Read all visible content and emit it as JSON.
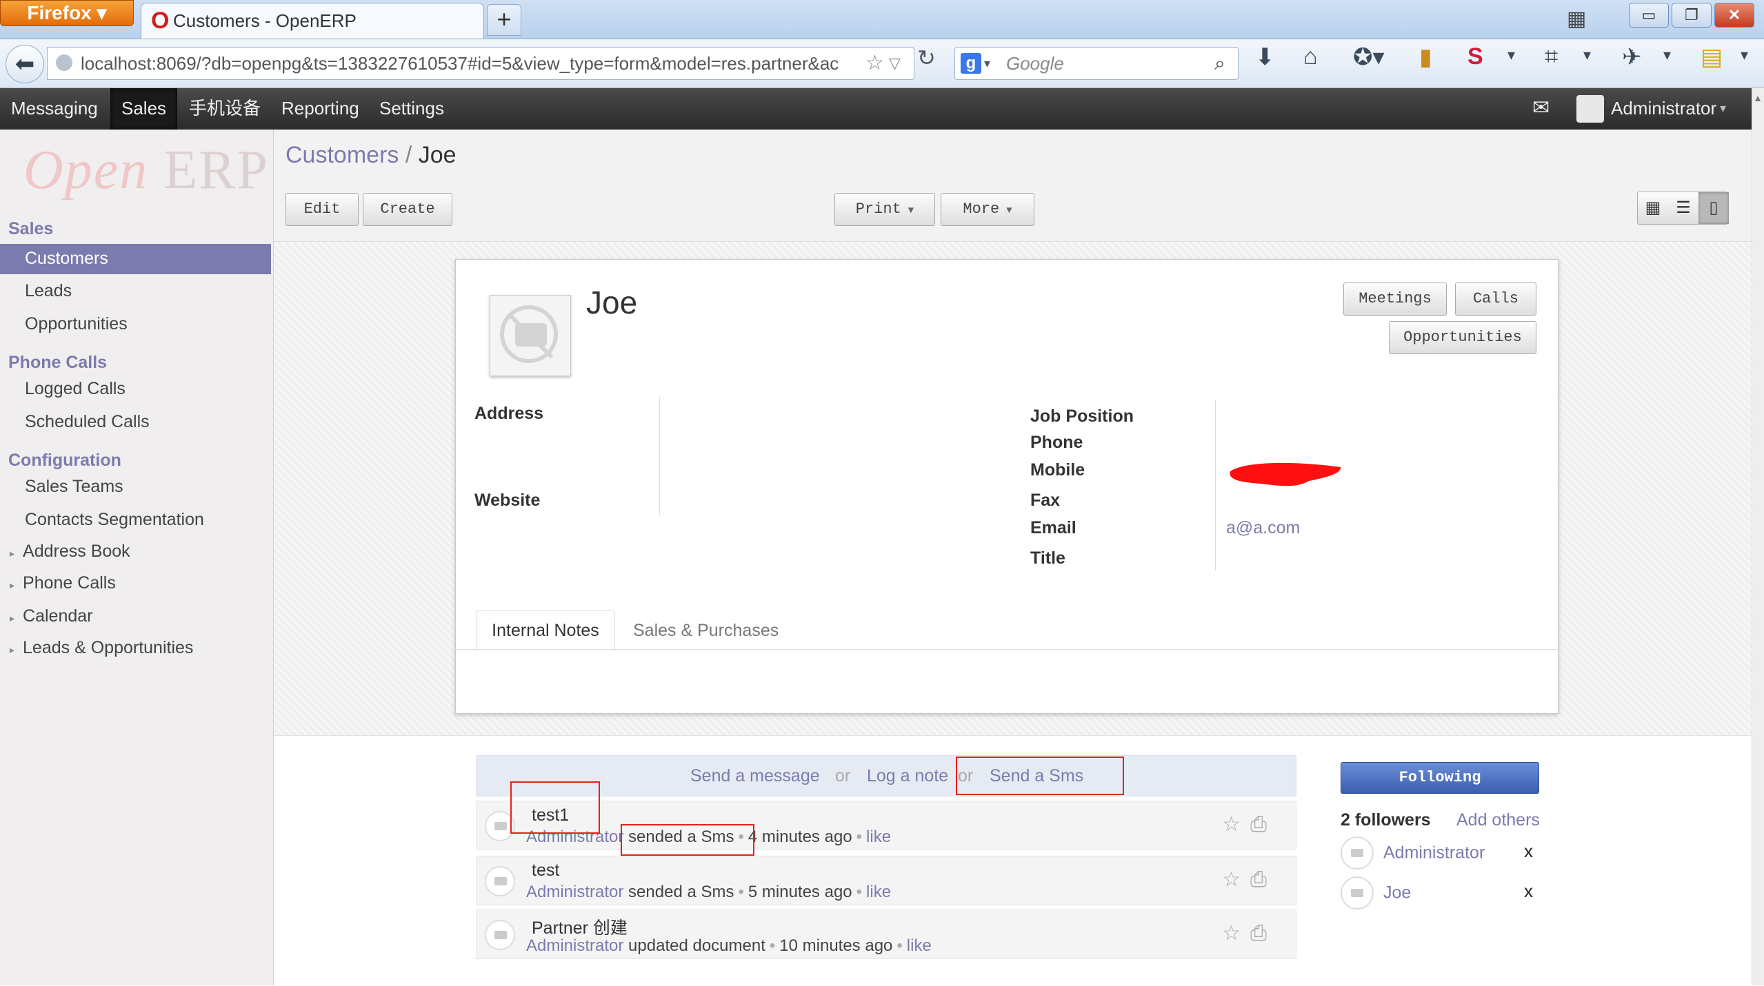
{
  "browser": {
    "menu_button": "Firefox",
    "tab_title": "Customers - OpenERP",
    "new_tab": "+",
    "url": "localhost:8069/?db=openpg&ts=1383227610537#id=5&view_type=form&model=res.partner&ac",
    "search_placeholder": "Google",
    "search_engine": "g"
  },
  "topbar": {
    "menus": [
      "Messaging",
      "Sales",
      "手机设备",
      "Reporting",
      "Settings"
    ],
    "active_menu": "Sales",
    "user": "Administrator"
  },
  "sidebar": {
    "logo_open": "Open",
    "logo_erp": "ERP",
    "sections": [
      {
        "title": "Sales",
        "items": [
          "Customers",
          "Leads",
          "Opportunities"
        ]
      },
      {
        "title": "Phone Calls",
        "items": [
          "Logged Calls",
          "Scheduled Calls"
        ]
      },
      {
        "title": "Configuration",
        "items": [
          "Sales Teams",
          "Contacts Segmentation"
        ]
      }
    ],
    "collapsed": [
      "Address Book",
      "Phone Calls",
      "Calendar",
      "Leads & Opportunities"
    ],
    "selected": "Customers"
  },
  "header": {
    "breadcrumb_parent": "Customers",
    "breadcrumb_sep": "/",
    "breadcrumb_current": "Joe",
    "edit": "Edit",
    "create": "Create",
    "print": "Print",
    "more": "More"
  },
  "form": {
    "name": "Joe",
    "buttons": {
      "meetings": "Meetings",
      "calls": "Calls",
      "opportunities": "Opportunities"
    },
    "left_labels": {
      "address": "Address",
      "website": "Website"
    },
    "right_labels": {
      "job_position": "Job Position",
      "phone": "Phone",
      "mobile": "Mobile",
      "fax": "Fax",
      "email": "Email",
      "title": "Title"
    },
    "email": "a@a.com",
    "tabs": [
      "Internal Notes",
      "Sales & Purchases"
    ]
  },
  "chatter": {
    "send_message": "Send a message",
    "or": "or",
    "log_note": "Log a note",
    "send_sms": "Send a Sms",
    "messages": [
      {
        "body": "test1",
        "author": "Administrator",
        "action": "sended a Sms",
        "time": "4 minutes ago",
        "like": "like"
      },
      {
        "body": "test",
        "author": "Administrator",
        "action": "sended a Sms",
        "time": "5 minutes ago",
        "like": "like"
      },
      {
        "body": "Partner 创建",
        "author": "Administrator",
        "action": "updated document",
        "time": "10 minutes ago",
        "like": "like"
      }
    ],
    "following": "Following",
    "followers_count": "2 followers",
    "add_others": "Add others",
    "followers": [
      "Administrator",
      "Joe"
    ],
    "remove": "x"
  },
  "colors": {
    "accent": "#7c7bad",
    "annotation": "#e2231a",
    "redact": "#ff0000"
  }
}
